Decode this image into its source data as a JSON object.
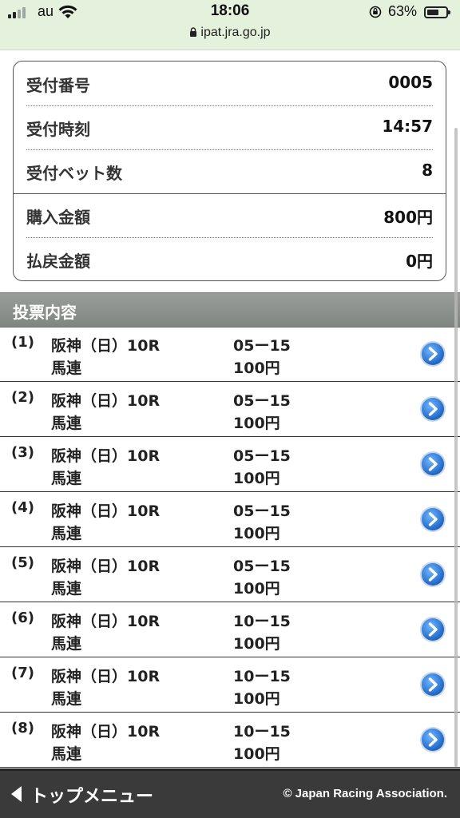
{
  "status_bar": {
    "carrier": "au",
    "time": "18:06",
    "battery_percent": "63%",
    "battery_level": 0.63,
    "url": "ipat.jra.go.jp",
    "icons": [
      "signal-icon",
      "wifi-icon",
      "orientation-lock-icon",
      "battery-icon",
      "lock-icon"
    ]
  },
  "summary": {
    "rows": [
      {
        "label": "受付番号",
        "value": "0005"
      },
      {
        "label": "受付時刻",
        "value": "14:57"
      },
      {
        "label": "受付ベット数",
        "value": "8"
      },
      {
        "label": "購入金額",
        "value": "800円"
      },
      {
        "label": "払戻金額",
        "value": "0円"
      }
    ]
  },
  "section": {
    "title": "投票内容"
  },
  "tickets": [
    {
      "num": "(1)",
      "race": "阪神（日）10R",
      "type": "馬連",
      "combo": "05ー15",
      "amount": "100円"
    },
    {
      "num": "(2)",
      "race": "阪神（日）10R",
      "type": "馬連",
      "combo": "05ー15",
      "amount": "100円"
    },
    {
      "num": "(3)",
      "race": "阪神（日）10R",
      "type": "馬連",
      "combo": "05ー15",
      "amount": "100円"
    },
    {
      "num": "(4)",
      "race": "阪神（日）10R",
      "type": "馬連",
      "combo": "05ー15",
      "amount": "100円"
    },
    {
      "num": "(5)",
      "race": "阪神（日）10R",
      "type": "馬連",
      "combo": "05ー15",
      "amount": "100円"
    },
    {
      "num": "(6)",
      "race": "阪神（日）10R",
      "type": "馬連",
      "combo": "10ー15",
      "amount": "100円"
    },
    {
      "num": "(7)",
      "race": "阪神（日）10R",
      "type": "馬連",
      "combo": "10ー15",
      "amount": "100円"
    },
    {
      "num": "(8)",
      "race": "阪神（日）10R",
      "type": "馬連",
      "combo": "10ー15",
      "amount": "100円"
    }
  ],
  "footer": {
    "back_label": "トップメニュー",
    "copyright": "© Japan Racing Association."
  },
  "colors": {
    "status_bg": "#e4f1dc",
    "section_header": "#8a8f8c",
    "footer_bg": "#3a3a3a",
    "arrow_blue": "#2a7fd6"
  }
}
